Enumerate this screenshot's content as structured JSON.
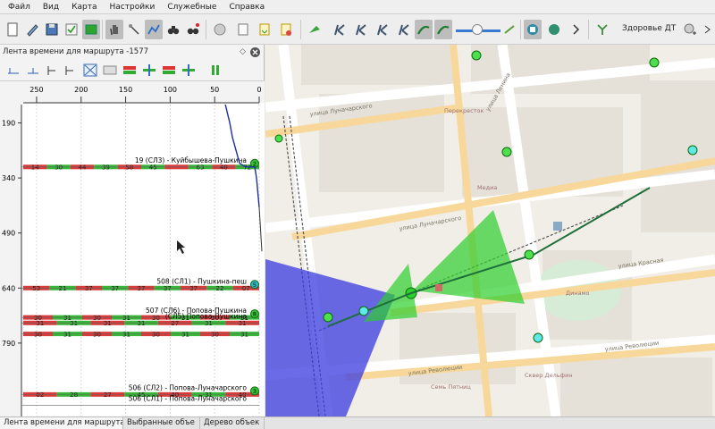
{
  "menu": [
    "Файл",
    "Вид",
    "Карта",
    "Настройки",
    "Служебные",
    "Справка"
  ],
  "toolbar": {
    "label": "Здоровье ДТ"
  },
  "panel": {
    "title": "Лента времени для маршрута -1577"
  },
  "chart_data": {
    "type": "line",
    "x_ticks": [
      "250",
      "200",
      "150",
      "100",
      "50",
      "0"
    ],
    "y_ticks": [
      "190",
      "340",
      "490",
      "640",
      "790"
    ],
    "stops": [
      {
        "label": "19 (СЛ3) - Куйбышева-Пушкина",
        "num": "2",
        "y": 310,
        "color": "#35c035",
        "band": [
          "14",
          "30",
          "44",
          "39",
          "58",
          "45",
          "",
          "63",
          "48",
          "72"
        ]
      },
      {
        "label": "508 (СЛ1) - Пушкина-пеш",
        "num": "5",
        "y": 640,
        "color": "#2fb7c8",
        "band": [
          "53",
          "21",
          "37",
          "37",
          "37",
          "37",
          "37",
          "22",
          "07"
        ]
      },
      {
        "label": "507 (СЛ6) - Попова-Пушкина",
        "num": "8",
        "y": 720,
        "color": "#35c035",
        "band": [
          "30",
          "31",
          "30",
          "31",
          "30",
          "31",
          "30",
          "31"
        ]
      },
      {
        "label": "(СЛ5) Попова-Пушкина",
        "num": "",
        "y": 735,
        "color": "#35c035",
        "band": [
          "31",
          "31",
          "31",
          "31",
          "27",
          "31",
          "31"
        ]
      },
      {
        "label": "",
        "num": "",
        "y": 765,
        "color": "#35c035",
        "band": [
          "30",
          "31",
          "30",
          "31",
          "30",
          "31",
          "30",
          "31"
        ]
      },
      {
        "label": "506 (СЛ2) - Попова-Луначарского",
        "num": "3",
        "y": 930,
        "color": "#35c035",
        "band": [
          "02",
          "28",
          "27",
          "45",
          "40",
          "31",
          "40"
        ]
      },
      {
        "label": "506 (СЛ1) - Попова-Луначарского",
        "num": "",
        "y": 960,
        "color": "#35c035",
        "band": []
      }
    ]
  },
  "map": {
    "streets": [
      "улица Луначарского",
      "улица Луначарского",
      "улица Красная",
      "улица Революции",
      "улица Революции",
      "улица Ленина"
    ],
    "pois": [
      "Перекресток",
      "Медиа",
      "Динамо",
      "Семь Пятниц",
      "Сквер Дельфин"
    ]
  },
  "tabs": [
    "Лента времени для маршрута -1",
    "Выбранные объе",
    "Дерево объек"
  ]
}
